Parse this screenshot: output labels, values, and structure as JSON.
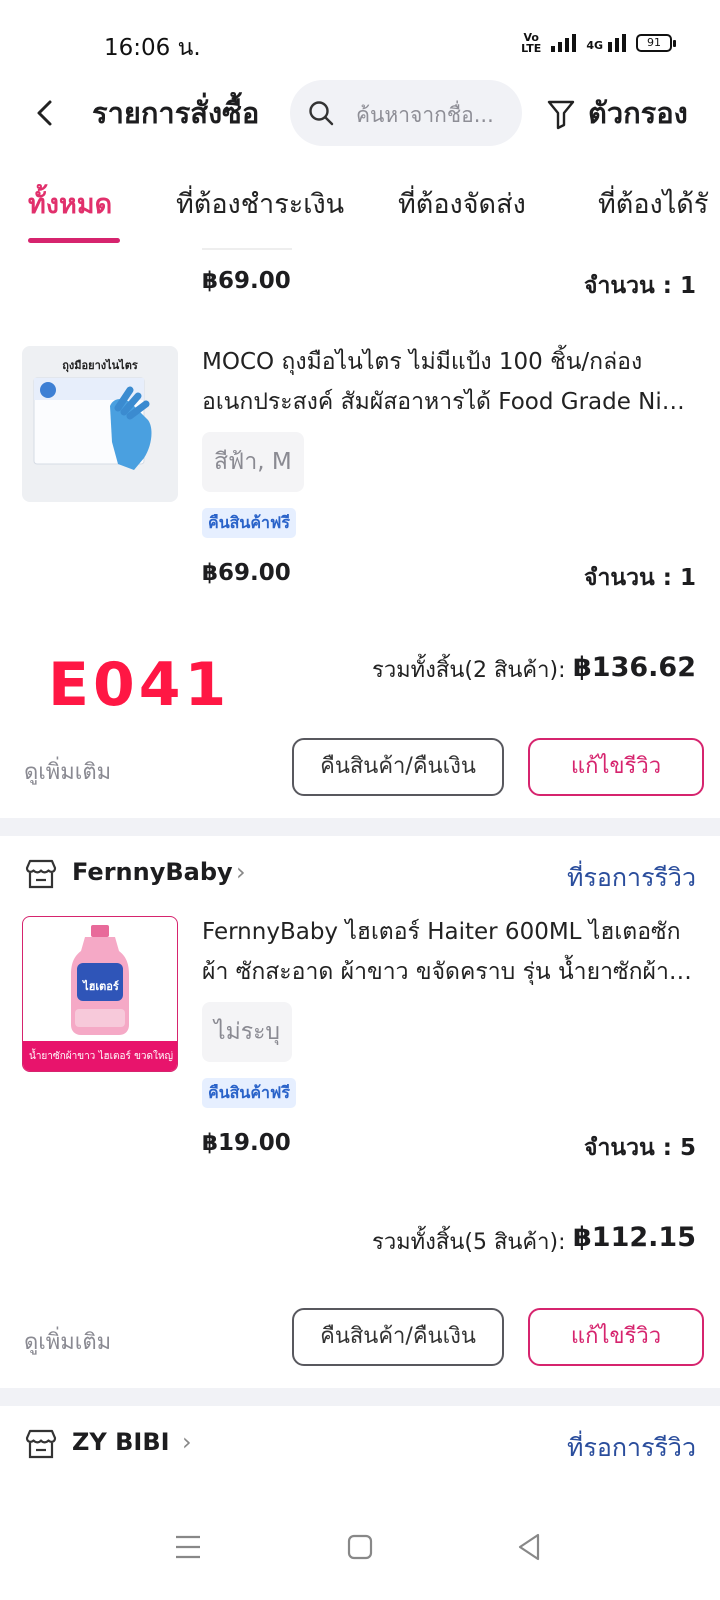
{
  "status_bar": {
    "time": "16:06 น.",
    "network": "4G",
    "volte": "Vo LTE",
    "battery": "91"
  },
  "header": {
    "title": "รายการสั่งซื้อ",
    "search_placeholder": "ค้นหาจากชื่อ...",
    "filter_label": "ตัวกรอง"
  },
  "tabs": [
    {
      "label": "ทั้งหมด",
      "active": true
    },
    {
      "label": "ที่ต้องชำระเงิน",
      "active": false
    },
    {
      "label": "ที่ต้องจัดส่ง",
      "active": false
    },
    {
      "label": "ที่ต้องได้รั",
      "active": false
    }
  ],
  "orders": [
    {
      "prev_item": {
        "price": "฿69.00",
        "quantity": "จำนวน : 1"
      },
      "item": {
        "name_line1": "MOCO ถุงมือไนไตร ไม่มีแป้ง 100 ชิ้น/กล่อง",
        "name_line2": "อเนกประสงค์ สัมผัสอาหารได้ Food Grade Nitr...",
        "thumb_text": "ถุงมือยางไนไตร",
        "variant": "สีฟ้า, M",
        "badge": "คืนสินค้าฟรี",
        "price": "฿69.00",
        "quantity": "จำนวน : 1"
      },
      "stamp": "E041",
      "total_label": "รวมทั้งสิ้น(2 สินค้า):",
      "total_value": "฿136.62",
      "more_label": "ดูเพิ่มเติม",
      "return_button": "คืนสินค้า/คืนเงิน",
      "review_button": "แก้ไขรีวิว"
    },
    {
      "shop": {
        "name": "FernnyBaby",
        "status": "ที่รอการรีวิว"
      },
      "item": {
        "name_line1": "FernnyBaby ไฮเตอร์ Haiter 600ML ไฮเตอซัก",
        "name_line2": "ผ้า ซักสะอาด ผ้าขาว ขจัดคราบ รุ่น น้ำยาซักผ้า ไฮเ...",
        "thumb_text": "น้ำยาซักผ้าขาว ไฮเตอร์ ขวดใหญ่",
        "thumb_bottle_label": "ไฮเตอร์",
        "variant": "ไม่ระบุ",
        "badge": "คืนสินค้าฟรี",
        "price": "฿19.00",
        "quantity": "จำนวน : 5"
      },
      "total_label": "รวมทั้งสิ้น(5 สินค้า):",
      "total_value": "฿112.15",
      "more_label": "ดูเพิ่มเติม",
      "return_button": "คืนสินค้า/คืนเงิน",
      "review_button": "แก้ไขรีวิว"
    },
    {
      "shop": {
        "name": "ZY BIBI",
        "status": "ที่รอการรีวิว"
      }
    }
  ],
  "colors": {
    "accent": "#d6246e",
    "link": "#2a4d9c",
    "stamp": "#ff1744",
    "badge_bg": "#e6efff"
  },
  "icons": [
    "back-icon",
    "search-icon",
    "filter-icon",
    "shop-icon",
    "chevron-right-icon",
    "menu-icon",
    "home-icon",
    "back-triangle-icon"
  ]
}
